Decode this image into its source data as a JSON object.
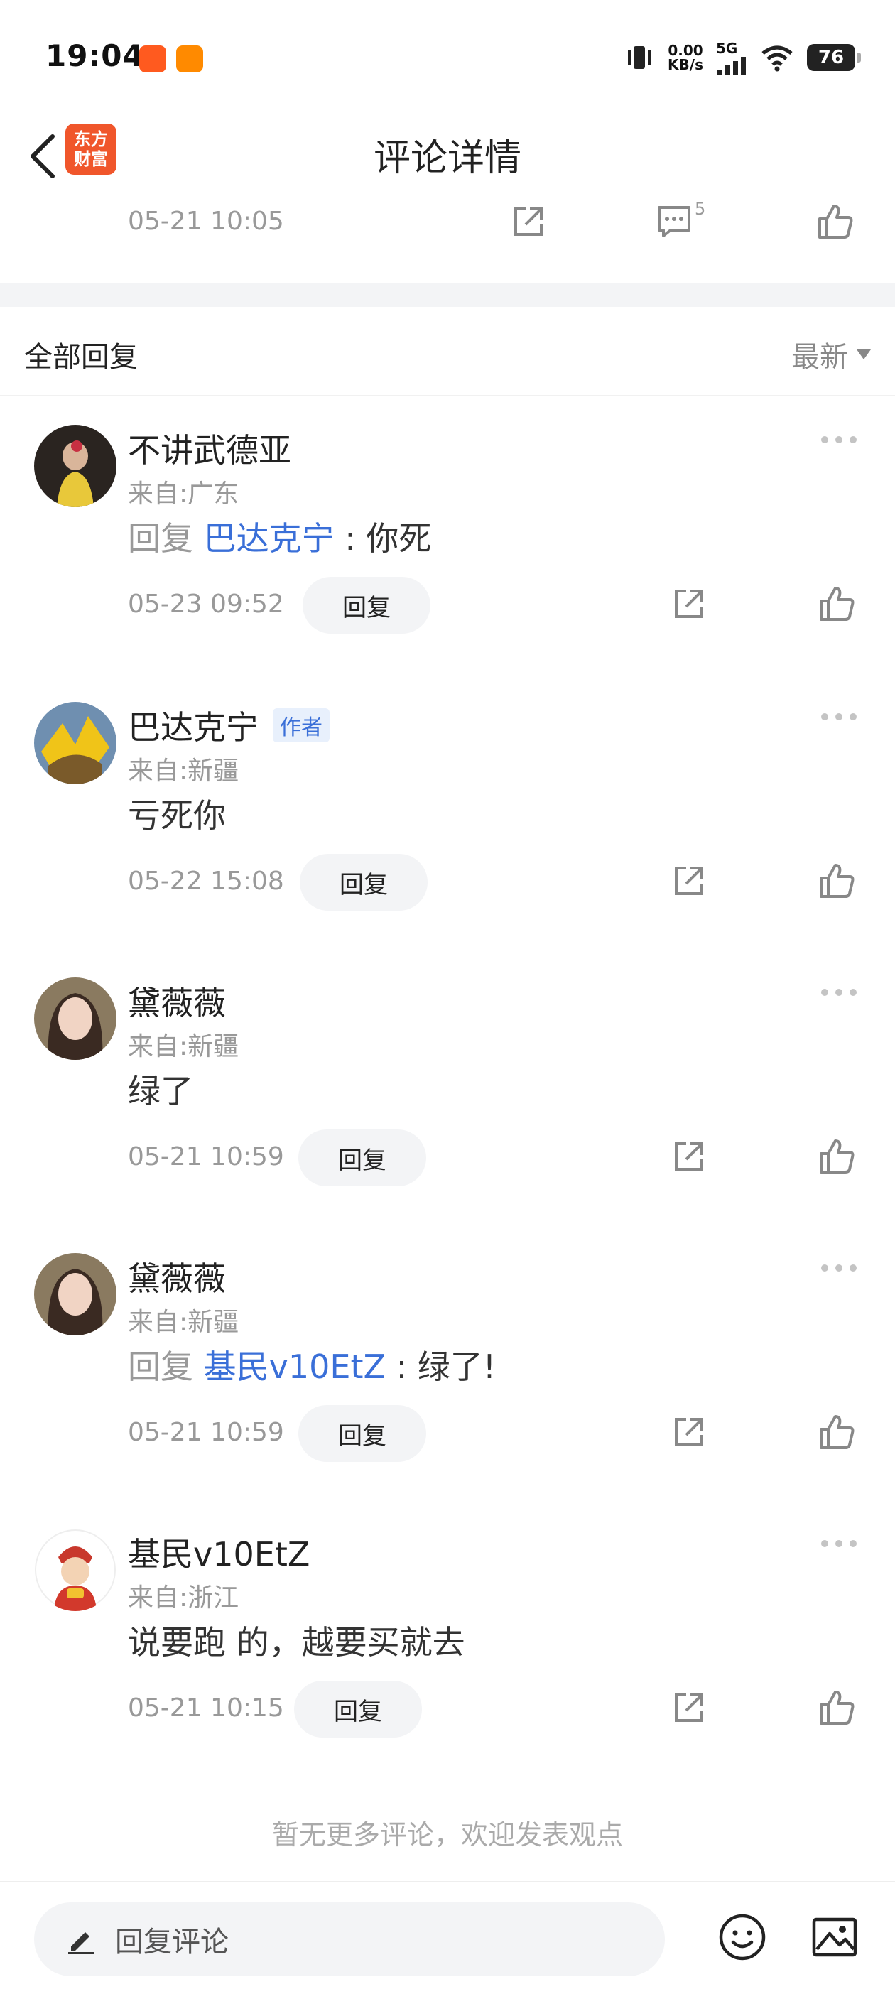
{
  "status_bar": {
    "time": "19:04",
    "speed_value": "0.00",
    "speed_unit": "KB/s",
    "network": "5G",
    "battery": "76"
  },
  "header": {
    "title": "评论详情",
    "logo_line1": "东方",
    "logo_line2": "财富"
  },
  "parent": {
    "time": "05-21 10:05",
    "comment_count": "5"
  },
  "section": {
    "title": "全部回复",
    "sort_label": "最新"
  },
  "comments": [
    {
      "name": "不讲武德亚",
      "location": "来自:广东",
      "reply_word": "回复",
      "reply_to": "巴达克宁",
      "text": " : 你死",
      "time": "05-23 09:52",
      "reply_label": "回复"
    },
    {
      "name": "巴达克宁",
      "badge": "作者",
      "location": "来自:新疆",
      "text": "亏死你",
      "time": "05-22 15:08",
      "reply_label": "回复"
    },
    {
      "name": "黛薇薇",
      "location": "来自:新疆",
      "text": "绿了",
      "time": "05-21 10:59",
      "reply_label": "回复"
    },
    {
      "name": "黛薇薇",
      "location": "来自:新疆",
      "reply_word": "回复",
      "reply_to": "基民v10EtZ",
      "text": " : 绿了!",
      "time": "05-21 10:59",
      "reply_label": "回复"
    },
    {
      "name": "基民v10EtZ",
      "location": "来自:浙江",
      "text": "说要跑 的，越要买就去",
      "time": "05-21 10:15",
      "reply_label": "回复"
    }
  ],
  "footer_note": "暂无更多评论，欢迎发表观点",
  "bottom_bar": {
    "input_placeholder": "回复评论"
  },
  "colors": {
    "accent_blue": "#3a6fd8",
    "brand_orange": "#f0562b"
  }
}
